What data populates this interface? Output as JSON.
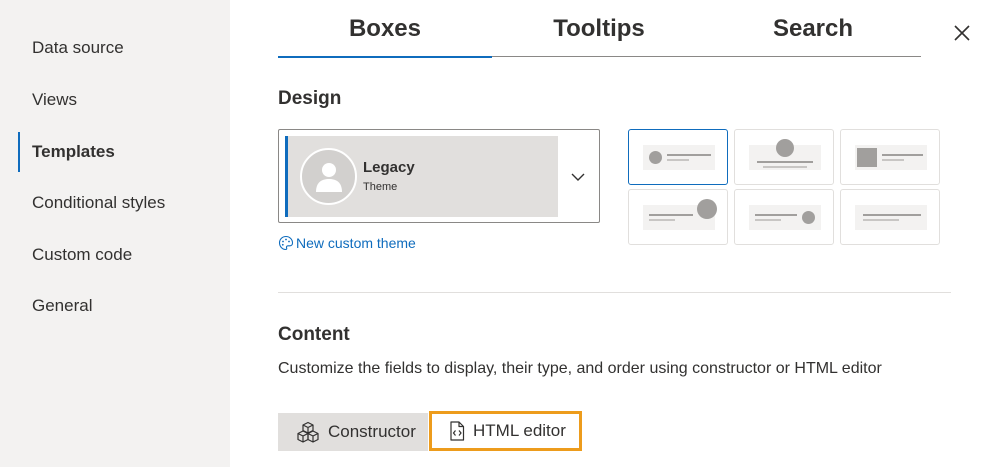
{
  "sidebar": {
    "items": [
      {
        "label": "Data source"
      },
      {
        "label": "Views"
      },
      {
        "label": "Templates",
        "active": true
      },
      {
        "label": "Conditional styles"
      },
      {
        "label": "Custom code"
      },
      {
        "label": "General"
      }
    ]
  },
  "tabs": [
    {
      "label": "Boxes",
      "active": true
    },
    {
      "label": "Tooltips"
    },
    {
      "label": "Search"
    }
  ],
  "design": {
    "title": "Design",
    "theme": {
      "name": "Legacy",
      "subtitle": "Theme"
    },
    "custom_theme_link": "New custom theme",
    "layouts_selected_index": 0
  },
  "content": {
    "title": "Content",
    "description": "Customize the fields to display, their type, and order using constructor or HTML editor",
    "constructor_label": "Constructor",
    "html_editor_label": "HTML editor"
  },
  "colors": {
    "accent": "#0f6cbd",
    "highlight": "#ed9c1c",
    "sidebar_bg": "#f3f2f1"
  }
}
